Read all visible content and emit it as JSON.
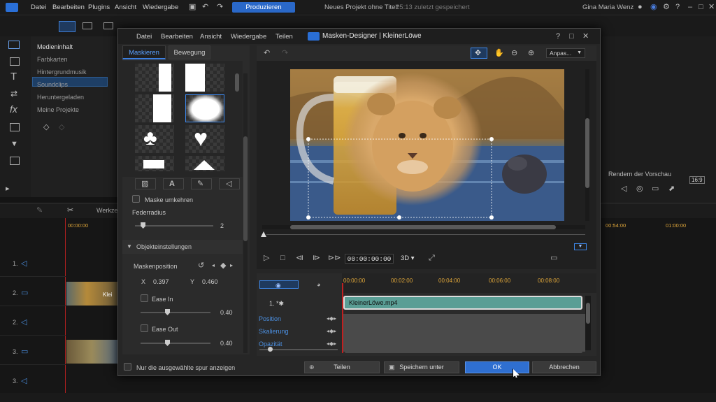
{
  "app": {
    "menu": [
      "Datei",
      "Bearbeiten",
      "Plugins",
      "Ansicht",
      "Wiedergabe"
    ],
    "produce_label": "Produzieren",
    "project_title": "Neues Projekt ohne Titel*",
    "project_saved": "15:13 zuletzt gespeichert",
    "user_name": "Gina Maria Wenz",
    "library_items": [
      "Medieninhalt",
      "Farbkarten",
      "Hintergrundmusik",
      "Soundclips",
      "Heruntergeladen",
      "Meine Projekte"
    ],
    "render_preview_label": "Rendern der Vorschau",
    "aspect_label": "16:9",
    "timeline": {
      "cut_label": "Werkze",
      "ruler_start": "00:00:00",
      "ruler_marks": [
        "00:54:00",
        "01:00:00"
      ],
      "tracks": [
        "1.",
        "2.",
        "2.",
        "3.",
        "3."
      ],
      "clip_label": "Klei"
    }
  },
  "dialog": {
    "menu": [
      "Datei",
      "Bearbeiten",
      "Ansicht",
      "Wiedergabe",
      "Teilen"
    ],
    "title": "Masken-Designer | KleinerLöwe",
    "tabs": [
      "Maskieren",
      "Bewegung"
    ],
    "invert_mask_label": "Maske umkehren",
    "feather_label": "Federradius",
    "feather_value": "2",
    "feather_fraction": 0.1,
    "object_settings_label": "Objekteinstellungen",
    "mask_position_label": "Maskenposition",
    "x_label": "X",
    "x_value": "0.397",
    "y_label": "Y",
    "y_value": "0.460",
    "ease_in_label": "Ease In",
    "ease_in_value": "0.40",
    "ease_out_label": "Ease Out",
    "ease_out_value": "0.40",
    "zoom_select": "Anpas...",
    "timecode": "00:00:00:00",
    "mode_3d": "3D",
    "kf_ticks": [
      "00:00:00",
      "00:02:00",
      "00:04:00",
      "00:06:00",
      "00:08:00"
    ],
    "track_label": "1.",
    "clip_label": "KleinerLöwe.mp4",
    "kf_rows": [
      "Position",
      "Skalierung",
      "Opazität"
    ],
    "only_selected_label": "Nur die ausgewählte spur anzeigen",
    "buttons": {
      "share": "Teilen",
      "save_as": "Speichern unter",
      "ok": "OK",
      "cancel": "Abbrechen"
    }
  }
}
